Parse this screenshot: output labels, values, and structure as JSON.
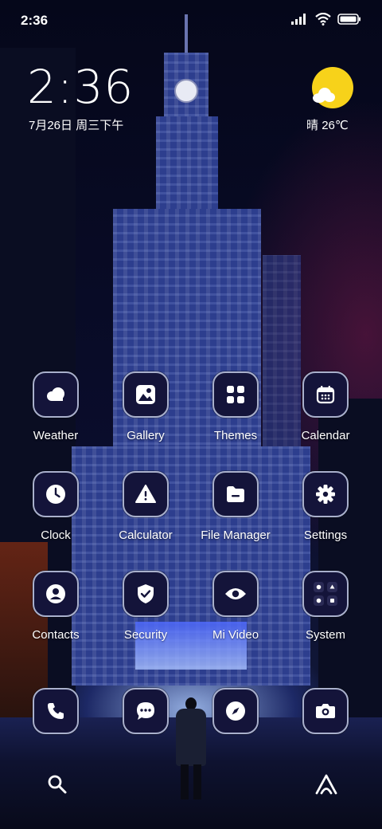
{
  "status_bar": {
    "time": "2:36"
  },
  "clock_widget": {
    "time": "2:36",
    "date": "7月26日 周三下午"
  },
  "weather_widget": {
    "condition": "晴",
    "temperature": "26℃",
    "sun_color": "#f7d21a"
  },
  "apps": [
    {
      "label": "Weather",
      "icon": "weather-icon"
    },
    {
      "label": "Gallery",
      "icon": "gallery-icon"
    },
    {
      "label": "Themes",
      "icon": "themes-icon"
    },
    {
      "label": "Calendar",
      "icon": "calendar-icon"
    },
    {
      "label": "Clock",
      "icon": "clock-icon"
    },
    {
      "label": "Calculator",
      "icon": "calculator-icon"
    },
    {
      "label": "File Manager",
      "icon": "file-manager-icon"
    },
    {
      "label": "Settings",
      "icon": "settings-icon"
    },
    {
      "label": "Contacts",
      "icon": "contacts-icon"
    },
    {
      "label": "Security",
      "icon": "security-icon"
    },
    {
      "label": "Mi Video",
      "icon": "mi-video-icon"
    },
    {
      "label": "System",
      "icon": "system-folder-icon"
    }
  ],
  "dock": [
    {
      "icon": "phone-icon"
    },
    {
      "icon": "messages-icon"
    },
    {
      "icon": "browser-icon"
    },
    {
      "icon": "camera-icon"
    }
  ],
  "bottom": {
    "left": "search-icon",
    "right": "launcher-icon"
  },
  "colors": {
    "icon_tile": "#14143a",
    "icon_border": "#a9b0cc",
    "text": "#ffffff"
  }
}
